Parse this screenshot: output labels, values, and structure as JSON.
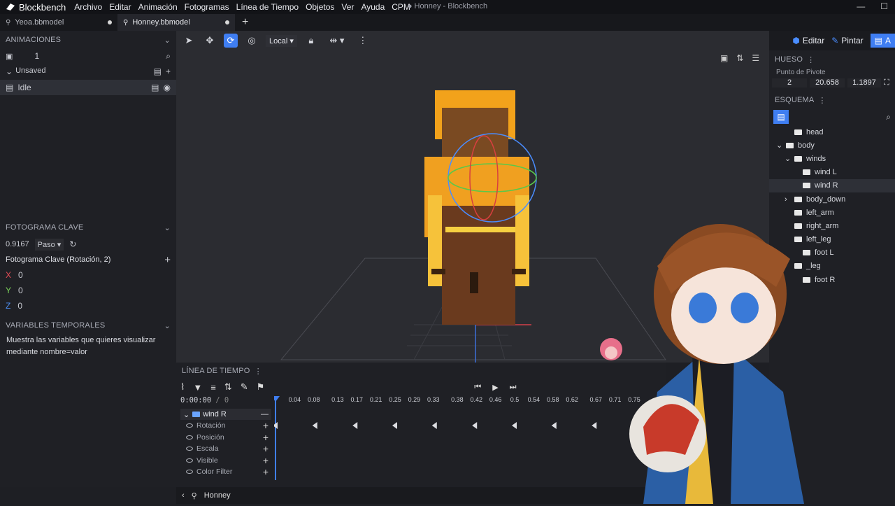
{
  "app": {
    "name": "Blockbench",
    "window_title": "● Honney - Blockbench"
  },
  "menu": [
    "Archivo",
    "Editar",
    "Animación",
    "Fotogramas",
    "Línea de Tiempo",
    "Objetos",
    "Ver",
    "Ayuda",
    "CPM"
  ],
  "tabs": [
    {
      "label": "Yeoa.bbmodel"
    },
    {
      "label": "Honney.bbmodel"
    }
  ],
  "toolbar": {
    "space": "Local"
  },
  "modes": {
    "edit": "Editar",
    "paint": "Pintar",
    "animate": "A"
  },
  "animations": {
    "header": "ANIMACIONES",
    "count": "1",
    "group": "Unsaved",
    "items": [
      {
        "name": "Idle"
      }
    ]
  },
  "keyframe": {
    "header": "FOTOGRAMA CLAVE",
    "time": "0.9167",
    "interp": "Paso",
    "title": "Fotograma Clave (Rotación, 2)",
    "axes": [
      {
        "axis": "X",
        "value": "0"
      },
      {
        "axis": "Y",
        "value": "0"
      },
      {
        "axis": "Z",
        "value": "0"
      }
    ]
  },
  "variables": {
    "header": "VARIABLES TEMPORALES",
    "text": "Muestra las variables que quieres visualizar mediante nombre=valor"
  },
  "bone": {
    "header": "HUESO",
    "pivot_label": "Punto de Pivote",
    "pivot": [
      "2",
      "20.658",
      "1.1897"
    ]
  },
  "outliner": {
    "header": "ESQUEMA",
    "items": [
      {
        "name": "head",
        "depth": 1
      },
      {
        "name": "body",
        "depth": 0
      },
      {
        "name": "winds",
        "depth": 1
      },
      {
        "name": "wind L",
        "depth": 2
      },
      {
        "name": "wind R",
        "depth": 2
      },
      {
        "name": "body_down",
        "depth": 1
      },
      {
        "name": "left_arm",
        "depth": 1
      },
      {
        "name": "right_arm",
        "depth": 1
      },
      {
        "name": "left_leg",
        "depth": 1
      },
      {
        "name": "foot L",
        "depth": 2
      },
      {
        "name": "_leg",
        "depth": 1
      },
      {
        "name": "foot R",
        "depth": 2
      }
    ]
  },
  "timeline": {
    "header": "LÍNEA DE TIEMPO",
    "time": "0:00:00",
    "frame": "/ 0",
    "ticks": [
      "0.04",
      "0.08",
      "0.13",
      "0.17",
      "0.21",
      "0.25",
      "0.29",
      "0.33",
      "0.38",
      "0.42",
      "0.46",
      "0.5",
      "0.54",
      "0.58",
      "0.62",
      "0.67",
      "0.71",
      "0.75"
    ],
    "bone": "wind R",
    "channels": [
      "Rotación",
      "Posición",
      "Escala",
      "Visible",
      "Color Filter"
    ],
    "rotation_keyframes": [
      0,
      0.083,
      0.167,
      0.25,
      0.333,
      0.417,
      0.5,
      0.583,
      0.667
    ]
  },
  "status": {
    "model": "Honney"
  },
  "colors": {
    "accent": "#3f7ef2",
    "x": "#e64c56",
    "y": "#7ad15a",
    "z": "#4c8df0"
  }
}
